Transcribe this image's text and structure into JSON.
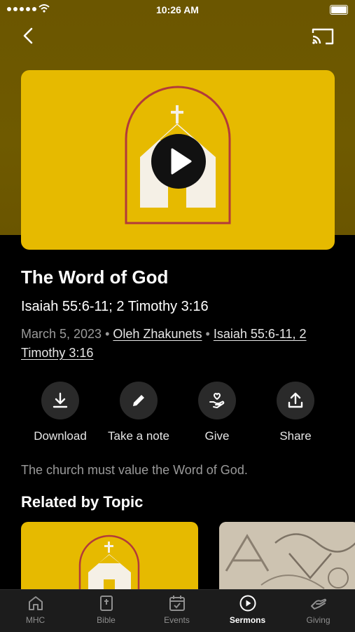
{
  "status_bar": {
    "time": "10:26 AM"
  },
  "sermon": {
    "title": "The Word of God",
    "scripture": "Isaiah 55:6-11; 2 Timothy 3:16",
    "date": "March 5, 2023",
    "speaker": "Oleh Zhakunets",
    "reference_link": "Isaiah 55:6-11, 2 Timothy 3:16",
    "description": "The church must value the Word of God."
  },
  "actions": [
    {
      "label": "Download",
      "icon": "download-icon"
    },
    {
      "label": "Take a note",
      "icon": "pencil-icon"
    },
    {
      "label": "Give",
      "icon": "give-hand-heart-icon"
    },
    {
      "label": "Share",
      "icon": "share-icon"
    }
  ],
  "related": {
    "heading": "Related by Topic"
  },
  "tabs": [
    {
      "label": "MHC",
      "icon": "home-icon",
      "active": false
    },
    {
      "label": "Bible",
      "icon": "bible-icon",
      "active": false
    },
    {
      "label": "Events",
      "icon": "calendar-icon",
      "active": false
    },
    {
      "label": "Sermons",
      "icon": "play-circle-icon",
      "active": true
    },
    {
      "label": "Giving",
      "icon": "giving-hand-icon",
      "active": false
    }
  ],
  "colors": {
    "accent": "#e6ba00",
    "header_bg": "#6b5600",
    "church_outline": "#b23a3a"
  }
}
